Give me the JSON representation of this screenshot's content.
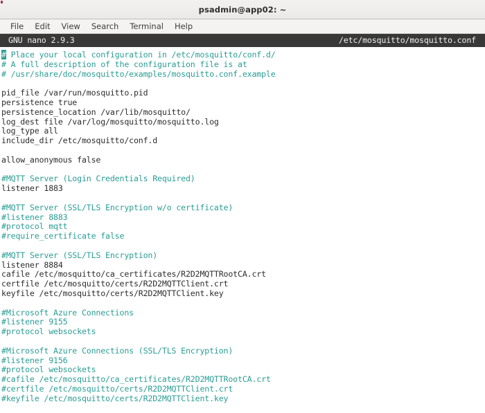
{
  "window": {
    "title": "psadmin@app02: ~"
  },
  "menubar": {
    "items": [
      {
        "label": "File",
        "name": "menu-file"
      },
      {
        "label": "Edit",
        "name": "menu-edit"
      },
      {
        "label": "View",
        "name": "menu-view"
      },
      {
        "label": "Search",
        "name": "menu-search"
      },
      {
        "label": "Terminal",
        "name": "menu-terminal"
      },
      {
        "label": "Help",
        "name": "menu-help"
      }
    ]
  },
  "editor": {
    "app_version": "GNU nano 2.9.3",
    "file_path": "/etc/mosquitto/mosquitto.conf",
    "cursor": {
      "line": 1,
      "column": 1,
      "char": "#"
    },
    "colors": {
      "comment": "#2a9d94",
      "text": "#2c2c2c",
      "background": "#ffffff",
      "statusbar_bg": "#383838",
      "statusbar_fg": "#f2f2f2"
    },
    "lines": [
      {
        "text": "# Place your local configuration in /etc/mosquitto/conf.d/",
        "comment": true,
        "cursor": true
      },
      {
        "text": "# A full description of the configuration file is at",
        "comment": true
      },
      {
        "text": "# /usr/share/doc/mosquitto/examples/mosquitto.conf.example",
        "comment": true
      },
      {
        "text": "",
        "comment": false
      },
      {
        "text": "pid_file /var/run/mosquitto.pid",
        "comment": false
      },
      {
        "text": "persistence true",
        "comment": false
      },
      {
        "text": "persistence_location /var/lib/mosquitto/",
        "comment": false
      },
      {
        "text": "log_dest file /var/log/mosquitto/mosquitto.log",
        "comment": false
      },
      {
        "text": "log_type all",
        "comment": false
      },
      {
        "text": "include_dir /etc/mosquitto/conf.d",
        "comment": false
      },
      {
        "text": "",
        "comment": false
      },
      {
        "text": "allow_anonymous false",
        "comment": false
      },
      {
        "text": "",
        "comment": false
      },
      {
        "text": "#MQTT Server (Login Credentials Required)",
        "comment": true
      },
      {
        "text": "listener 1883",
        "comment": false
      },
      {
        "text": "",
        "comment": false
      },
      {
        "text": "#MQTT Server (SSL/TLS Encryption w/o certificate)",
        "comment": true
      },
      {
        "text": "#listener 8883",
        "comment": true
      },
      {
        "text": "#protocol mqtt",
        "comment": true
      },
      {
        "text": "#require_certificate false",
        "comment": true
      },
      {
        "text": "",
        "comment": false
      },
      {
        "text": "#MQTT Server (SSL/TLS Encryption)",
        "comment": true
      },
      {
        "text": "listener 8884",
        "comment": false
      },
      {
        "text": "cafile /etc/mosquitto/ca_certificates/R2D2MQTTRootCA.crt",
        "comment": false
      },
      {
        "text": "certfile /etc/mosquitto/certs/R2D2MQTTClient.crt",
        "comment": false
      },
      {
        "text": "keyfile /etc/mosquitto/certs/R2D2MQTTClient.key",
        "comment": false
      },
      {
        "text": "",
        "comment": false
      },
      {
        "text": "#Microsoft Azure Connections",
        "comment": true
      },
      {
        "text": "#listener 9155",
        "comment": true
      },
      {
        "text": "#protocol websockets",
        "comment": true
      },
      {
        "text": "",
        "comment": false
      },
      {
        "text": "#Microsoft Azure Connections (SSL/TLS Encryption)",
        "comment": true
      },
      {
        "text": "#listener 9156",
        "comment": true
      },
      {
        "text": "#protocol websockets",
        "comment": true
      },
      {
        "text": "#cafile /etc/mosquitto/ca_certificates/R2D2MQTTRootCA.crt",
        "comment": true
      },
      {
        "text": "#certfile /etc/mosquitto/certs/R2D2MQTTClient.crt",
        "comment": true
      },
      {
        "text": "#keyfile /etc/mosquitto/certs/R2D2MQTTClient.key",
        "comment": true
      }
    ]
  }
}
